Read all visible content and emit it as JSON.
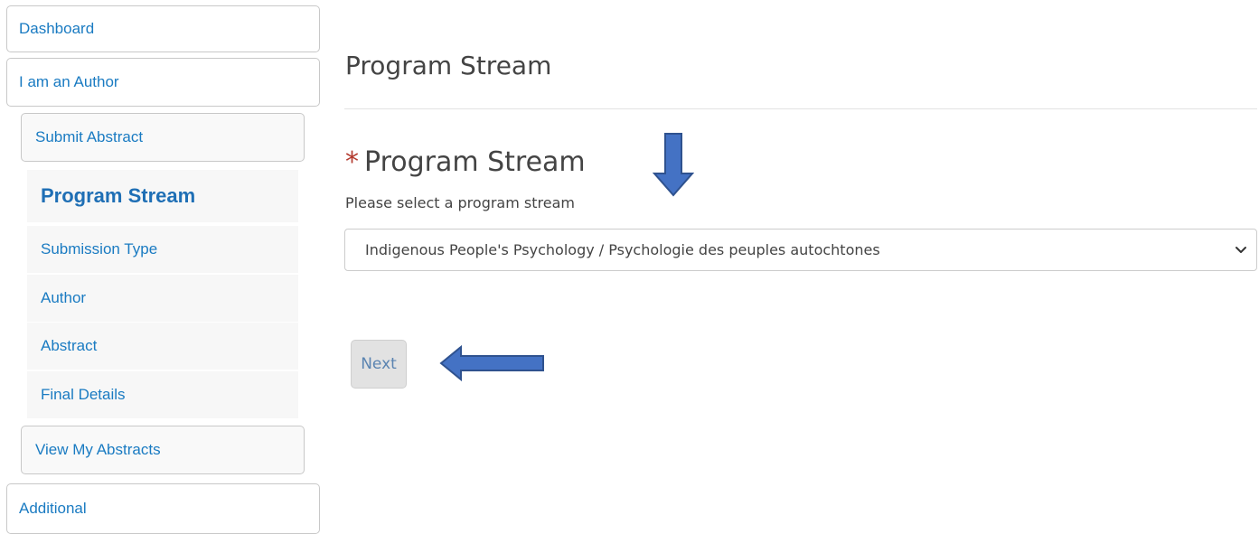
{
  "sidebar": {
    "dashboard": "Dashboard",
    "author": "I am an Author",
    "submit_abstract": "Submit Abstract",
    "steps": [
      {
        "label": "Program Stream",
        "active": true
      },
      {
        "label": "Submission Type"
      },
      {
        "label": "Author"
      },
      {
        "label": "Abstract"
      },
      {
        "label": "Final Details"
      }
    ],
    "view_abstracts": "View My Abstracts",
    "additional": "Additional"
  },
  "main": {
    "title": "Program Stream",
    "field": {
      "required_mark": "*",
      "label": "Program Stream",
      "help": "Please select a program stream",
      "selected_value": "Indigenous People's Psychology / Psychologie des peuples autochtones"
    },
    "next_label": "Next"
  },
  "colors": {
    "link": "#1a7bc2",
    "required": "#b33a2e",
    "arrow_fill": "#4472c4",
    "arrow_stroke": "#2f528f"
  }
}
